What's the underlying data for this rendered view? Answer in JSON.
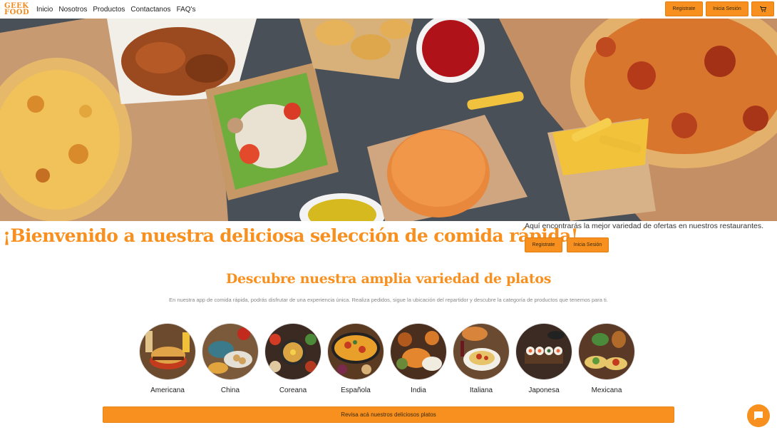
{
  "brand": {
    "logo_line1": "GEEK",
    "logo_line2": "FOOD"
  },
  "nav": {
    "links": [
      "Inicio",
      "Nosotros",
      "Productos",
      "Contactanos",
      "FAQ's"
    ],
    "register": "Registrate",
    "login": "Inicia Sesión",
    "cart_icon": "cart-icon"
  },
  "welcome": {
    "title": "¡Bienvenido a nuestra deliciosa selección de comida rápida!",
    "text": "Aquí encontrarás la mejor variedad de ofertas en nuestros restaurantes.",
    "register": "Registrate",
    "login": "Inicia Sesión"
  },
  "section": {
    "title": "Descubre nuestra amplia variedad de platos",
    "description": "En nuestra app de comida rápida, podrás disfrutar de una experiencia única. Realiza pedidos, sigue la ubicación del repartidor y descubre la categoría de productos que tenemos para ti."
  },
  "categories": [
    {
      "label": "Americana"
    },
    {
      "label": "China"
    },
    {
      "label": "Coreana"
    },
    {
      "label": "Española"
    },
    {
      "label": "India"
    },
    {
      "label": "Italiana"
    },
    {
      "label": "Japonesa"
    },
    {
      "label": "Mexicana"
    }
  ],
  "cta": {
    "label": "Revisa acá nuestros deliciosos platos"
  },
  "colors": {
    "accent": "#f7901e",
    "text": "#222222",
    "muted": "#888888"
  }
}
